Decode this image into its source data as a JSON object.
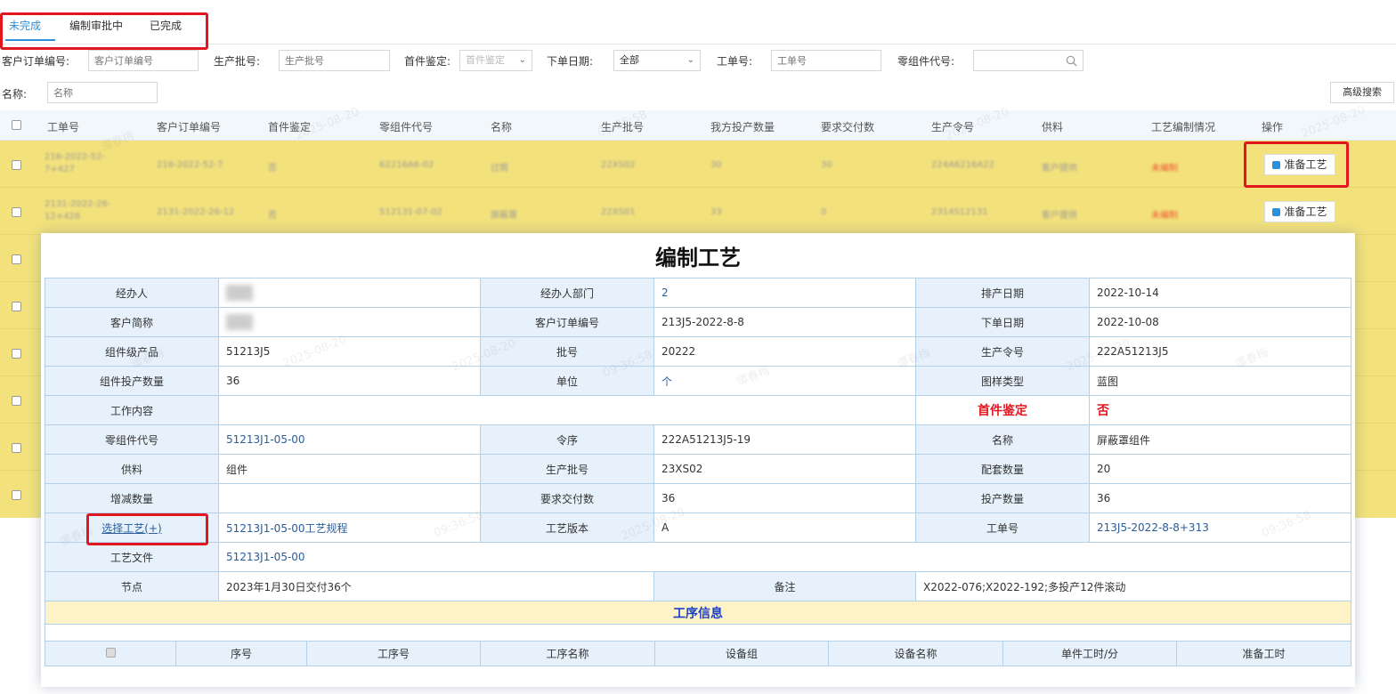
{
  "tabs": [
    {
      "label": "未完成",
      "active": true
    },
    {
      "label": "编制审批中",
      "active": false
    },
    {
      "label": "已完成",
      "active": false
    }
  ],
  "filters": {
    "customer_order_no": {
      "label": "客户订单编号:",
      "placeholder": "客户订单编号"
    },
    "batch_no": {
      "label": "生产批号:",
      "placeholder": "生产批号"
    },
    "first_article": {
      "label": "首件鉴定:",
      "placeholder": "首件鉴定"
    },
    "order_date": {
      "label": "下单日期:",
      "value": "全部"
    },
    "work_order": {
      "label": "工单号:",
      "placeholder": "工单号"
    },
    "part_code": {
      "label": "零组件代号:",
      "placeholder": ""
    },
    "name": {
      "label": "名称:",
      "placeholder": "名称"
    },
    "advanced_search": "高级搜索"
  },
  "grid": {
    "headers": [
      "工单号",
      "客户订单编号",
      "首件鉴定",
      "零组件代号",
      "名称",
      "生产批号",
      "我方投产数量",
      "要求交付数",
      "生产令号",
      "供料",
      "工艺编制情况",
      "操作"
    ],
    "rows": [
      {
        "work_order": "216-2022-52-7+427",
        "customer_order": "216-2022-52-7",
        "first": "否",
        "part": "62216A6-02",
        "name": "过筒",
        "batch": "22XS02",
        "qty": "30",
        "deliver": "30",
        "prod_order": "224A6216A22",
        "supply": "客户提供",
        "status": "未编制",
        "action": "准备工艺"
      },
      {
        "work_order": "2131-2022-26-12+426",
        "customer_order": "2131-2022-26-12",
        "first": "否",
        "part": "512131-07-02",
        "name": "屏蔽罩",
        "batch": "22XS01",
        "qty": "33",
        "deliver": "0",
        "prod_order": "2314S12131",
        "supply": "客户提供",
        "status": "未编制",
        "action": "准备工艺"
      }
    ]
  },
  "watermark": {
    "name": "谭春梅",
    "date": "2025-08-20",
    "time": "09:36:58"
  },
  "modal": {
    "title": "编制工艺",
    "fields": {
      "handler_label": "经办人",
      "handler_dept_label": "经办人部门",
      "handler_dept": "2",
      "schedule_date_label": "排产日期",
      "schedule_date": "2022-10-14",
      "customer_short_label": "客户简称",
      "customer_order_label": "客户订单编号",
      "customer_order": "213J5-2022-8-8",
      "order_date_label": "下单日期",
      "order_date": "2022-10-08",
      "component_label": "组件级产品",
      "component": "51213J5",
      "batch_label": "批号",
      "batch": "20222",
      "prod_order_label": "生产令号",
      "prod_order": "222A51213J5",
      "component_qty_label": "组件投产数量",
      "component_qty": "36",
      "unit_label": "单位",
      "unit": "个",
      "drawing_type_label": "图样类型",
      "drawing_type": "蓝图",
      "work_content_label": "工作内容",
      "first_article_label": "首件鉴定",
      "first_article": "否",
      "part_code_label": "零组件代号",
      "part_code": "51213J1-05-00",
      "sequence_label": "令序",
      "sequence": "222A51213J5-19",
      "name_label": "名称",
      "name": "屏蔽罩组件",
      "supply_label": "供料",
      "supply": "组件",
      "prod_batch_label": "生产批号",
      "prod_batch": "23XS02",
      "kit_qty_label": "配套数量",
      "kit_qty": "20",
      "adjust_qty_label": "增减数量",
      "deliver_qty_label": "要求交付数",
      "deliver_qty": "36",
      "invest_qty_label": "投产数量",
      "invest_qty": "36",
      "select_process": "选择工艺(+)",
      "process_spec": "51213J1-05-00工艺规程",
      "process_version_label": "工艺版本",
      "process_version": "A",
      "work_order_label": "工单号",
      "work_order": "213J5-2022-8-8+313",
      "process_file_label": "工艺文件",
      "process_file": "51213J1-05-00",
      "milestone_label": "节点",
      "milestone": "2023年1月30日交付36个",
      "remark_label": "备注",
      "remark": "X2022-076;X2022-192;多投产12件滚动"
    },
    "section_title": "工序信息",
    "process_headers": [
      "序号",
      "工序号",
      "工序名称",
      "设备组",
      "设备名称",
      "单件工时/分",
      "准备工时"
    ]
  },
  "colors": {
    "accent": "#2f8fd8",
    "highlight_row": "#f3e27c",
    "annotation_red": "#e1161e"
  }
}
